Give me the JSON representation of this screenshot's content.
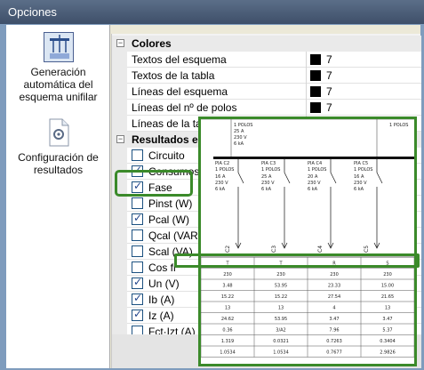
{
  "window": {
    "title": "Opciones"
  },
  "nav": {
    "items": [
      {
        "label": "Generación automática del esquema unifilar",
        "active": true,
        "icon": "schema-icon"
      },
      {
        "label": "Configuración de resultados",
        "active": false,
        "icon": "document-gear-icon"
      }
    ]
  },
  "grid": {
    "colors_category": "Colores",
    "color_rows": [
      {
        "name": "Textos del esquema",
        "value": "7"
      },
      {
        "name": "Textos de la tabla",
        "value": "7"
      },
      {
        "name": "Líneas del esquema",
        "value": "7"
      },
      {
        "name": "Líneas del nº de polos",
        "value": "7"
      },
      {
        "name": "Líneas de la tabla",
        "value": "7"
      }
    ],
    "results_category": "Resultados en",
    "result_rows": [
      {
        "name": "Circuito",
        "checked": false
      },
      {
        "name": "Consumos",
        "checked": true
      },
      {
        "name": "Fase",
        "checked": true
      },
      {
        "name": "Pinst (W)",
        "checked": false
      },
      {
        "name": "Pcal (W)",
        "checked": true
      },
      {
        "name": "Qcal (VAR)",
        "checked": false
      },
      {
        "name": "Scal (VA)",
        "checked": false
      },
      {
        "name": "Cos fi",
        "checked": false
      },
      {
        "name": "Un (V)",
        "checked": true
      },
      {
        "name": "Ib (A)",
        "checked": true
      },
      {
        "name": "Iz (A)",
        "checked": true
      },
      {
        "name": "Fct·Izt (A)",
        "checked": false
      }
    ]
  },
  "preview": {
    "header_poles": "1 POLOS",
    "breakers": [
      {
        "circuit": "C2",
        "poles": "1 POLOS",
        "pia": "PIA C2",
        "amps": "16 A",
        "volts": "230 V",
        "ka": "6 kA"
      },
      {
        "circuit": "C3",
        "poles": "1 POLOS",
        "pia": "PIA C3",
        "amps": "25 A",
        "volts": "230 V",
        "ka": "6 kA"
      },
      {
        "circuit": "C4",
        "poles": "1 POLOS",
        "pia": "PIA C4",
        "amps": "20 A",
        "volts": "230 V",
        "ka": "6 kA"
      },
      {
        "circuit": "C5",
        "poles": "1 POLOS",
        "pia": "PIA C5",
        "amps": "16 A",
        "volts": "230 V",
        "ka": "6 kA"
      }
    ],
    "table_rows": [
      [
        "T",
        "T",
        "R",
        "S"
      ],
      [
        "230",
        "230",
        "230",
        "230"
      ],
      [
        "3.48",
        "53.95",
        "23.33",
        "15.00"
      ],
      [
        "15.22",
        "15.22",
        "27.54",
        "21.65"
      ],
      [
        "13",
        "13",
        "4",
        "13"
      ],
      [
        "24.62",
        "53.95",
        "3.47",
        "3.47"
      ],
      [
        "0.36",
        "3/A2",
        "7.96",
        "5.37"
      ],
      [
        "1.319",
        "0.0321",
        "0.7263",
        "0.3404"
      ],
      [
        "1.0534",
        "1.0534",
        "0.7677",
        "2.9826"
      ]
    ]
  }
}
